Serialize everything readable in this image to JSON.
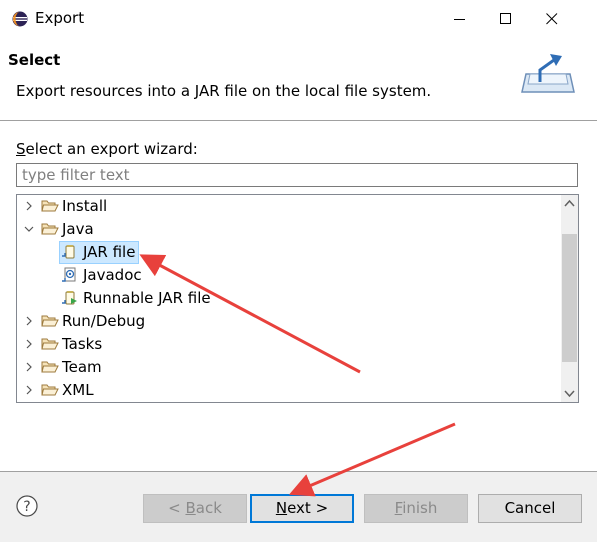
{
  "window": {
    "title": "Export",
    "minimize_icon": "minimize-icon",
    "maximize_icon": "maximize-icon",
    "close_icon": "close-icon"
  },
  "banner": {
    "title": "Select",
    "description": "Export resources into a JAR file on the local file system.",
    "icon": "export-wizard-icon"
  },
  "wizard": {
    "label_prefix": "",
    "label_mnemonic": "S",
    "label_rest": "elect an export wizard:",
    "filter_placeholder": "type filter text",
    "filter_value": "",
    "tree": [
      {
        "label": "Install",
        "kind": "folder",
        "expanded": false,
        "level": 0
      },
      {
        "label": "Java",
        "kind": "folder",
        "expanded": true,
        "level": 0
      },
      {
        "label": "JAR file",
        "kind": "jar",
        "level": 1,
        "selected": true
      },
      {
        "label": "Javadoc",
        "kind": "javadoc",
        "level": 1
      },
      {
        "label": "Runnable JAR file",
        "kind": "runnable-jar",
        "level": 1
      },
      {
        "label": "Run/Debug",
        "kind": "folder",
        "expanded": false,
        "level": 0
      },
      {
        "label": "Tasks",
        "kind": "folder",
        "expanded": false,
        "level": 0
      },
      {
        "label": "Team",
        "kind": "folder",
        "expanded": false,
        "level": 0
      },
      {
        "label": "XML",
        "kind": "folder",
        "expanded": false,
        "level": 0
      }
    ]
  },
  "footer": {
    "help_icon": "help-icon",
    "back": {
      "prefix": "< ",
      "mnemonic": "B",
      "rest": "ack",
      "enabled": false
    },
    "next": {
      "prefix": "",
      "mnemonic": "N",
      "rest": "ext >",
      "enabled": true
    },
    "finish": {
      "prefix": "",
      "mnemonic": "F",
      "rest": "inish",
      "enabled": false
    },
    "cancel": {
      "label": "Cancel",
      "enabled": true
    }
  },
  "colors": {
    "annotation_arrow": "#e8413c",
    "selection_bg": "#cce8ff",
    "default_button_border": "#0078d7",
    "folder": "#dcb67a"
  }
}
